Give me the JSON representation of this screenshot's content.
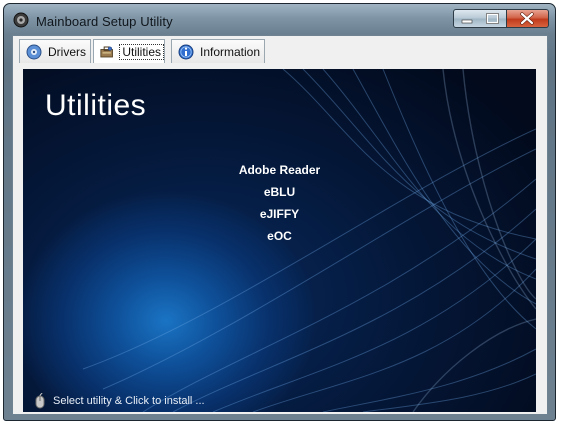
{
  "window": {
    "title": "Mainboard Setup Utility"
  },
  "tabs": [
    {
      "label": "Drivers",
      "icon": "gear-disc-icon"
    },
    {
      "label": "Utilities",
      "icon": "toolbox-icon",
      "selected": true
    },
    {
      "label": "Information",
      "icon": "info-icon"
    }
  ],
  "content": {
    "heading": "Utilities",
    "items": [
      "Adobe Reader",
      "eBLU",
      "eJIFFY",
      "eOC"
    ]
  },
  "status": {
    "text": "Select utility & Click to install ..."
  },
  "colors": {
    "accent": "#0e4f98",
    "panel_dark": "#020a1c"
  }
}
